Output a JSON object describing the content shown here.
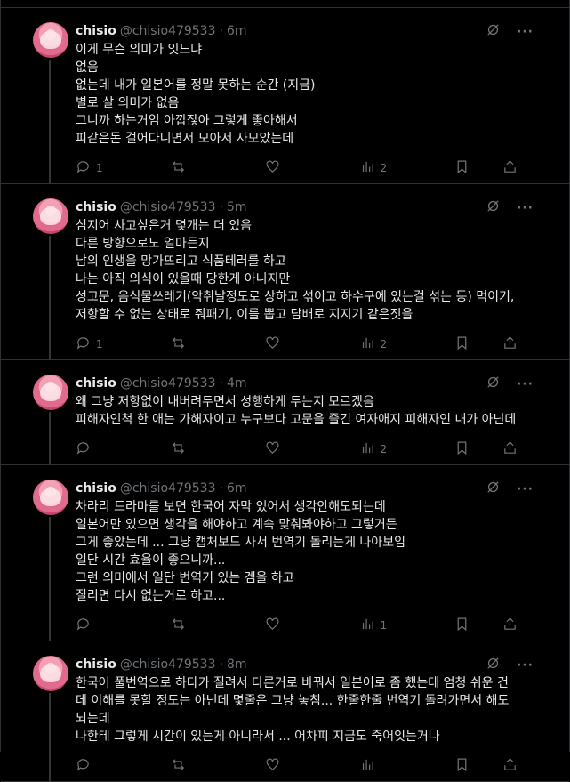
{
  "tweets": [
    {
      "name": "chisio",
      "handle": "@chisio479533",
      "time": "6m",
      "lines": [
        "이게 무슨 의미가 잇느냐",
        "없음",
        "없는데 내가 일본어를 정말 못하는 순간 (지금)",
        "별로 살 의미가 없음",
        "그니까 하는거임 아깝잖아 그렇게 좋아해서",
        "피같은돈 걸어다니면서 모아서 사모았는데"
      ],
      "replies": "1",
      "reposts": "",
      "likes": "",
      "views": "2"
    },
    {
      "name": "chisio",
      "handle": "@chisio479533",
      "time": "5m",
      "lines": [
        "심지어 사고싶은거 몇개는 더 있음",
        "다른 방향으로도 얼마든지",
        "남의 인생을 망가뜨리고 식품테러를 하고",
        "나는 아직 의식이 있을때 당한게 아니지만",
        "성고문, 음식물쓰레기(악취날정도로 상하고 섞이고 하수구에 있는걸 섞는 등) 먹이기,",
        "저항할 수 없는 상태로 줘패기, 이를 뽑고 담배로 지지기 같은짓을"
      ],
      "replies": "1",
      "reposts": "",
      "likes": "",
      "views": "2"
    },
    {
      "name": "chisio",
      "handle": "@chisio479533",
      "time": "4m",
      "lines": [
        "왜 그냥 저항없이 내버려두면서 성행하게 두는지 모르겠음",
        "피해자인척 한 애는 가해자이고 누구보다 고문을 즐긴 여자애지 피해자인 내가 아닌데"
      ],
      "replies": "",
      "reposts": "",
      "likes": "",
      "views": "2"
    },
    {
      "name": "chisio",
      "handle": "@chisio479533",
      "time": "6m",
      "lines": [
        "차라리 드라마를 보면 한국어 자막 있어서 생각안해도되는데",
        "일본어만 있으면 생각을 해야하고 계속 맞춰봐야하고 그렇거든",
        "그게 좋았는데 ... 그냥 캡처보드 사서 번역기 돌리는게 나아보임",
        "일단 시간 효율이 좋으니까...",
        "그런 의미에서 일단 번역기 있는 겜을 하고",
        "질리면 다시 없는거로 하고..."
      ],
      "replies": "",
      "reposts": "",
      "likes": "",
      "views": "1"
    },
    {
      "name": "chisio",
      "handle": "@chisio479533",
      "time": "8m",
      "lines": [
        "한국어 풀번역으로 하다가 질려서 다른거로 바꿔서 일본어로 좀 했는데 엄청 쉬운 건",
        "데 이해를 못할 정도는 아닌데 몇줄은 그냥 놓침... 한줄한줄 번역기 돌려가면서 해도",
        "되는데",
        "나한테 그렇게 시간이 있는게 아니라서 ... 어차피 지금도 죽어잇는거나"
      ],
      "replies": "",
      "reposts": "",
      "likes": "",
      "views": ""
    }
  ],
  "icons": {
    "reply": "reply-icon",
    "repost": "repost-icon",
    "like": "heart-icon",
    "views": "views-icon",
    "bookmark": "bookmark-icon",
    "share": "share-icon",
    "grok": "grok-icon",
    "more": "more-icon"
  }
}
